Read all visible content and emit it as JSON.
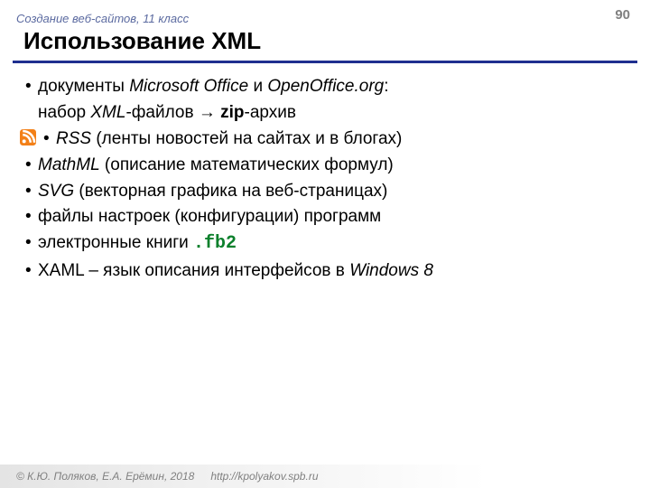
{
  "header": {
    "course": "Создание веб-сайтов, 11 класс"
  },
  "page_number": "90",
  "title": "Использование XML",
  "items": [
    {
      "pre": "документы ",
      "em1": "Microsoft Office",
      "mid": " и ",
      "em2": "OpenOffice.org",
      "post": ":",
      "sub_pre": "набор ",
      "sub_em": "XML",
      "sub_mid": "-файлов → ",
      "sub_b": "zip",
      "sub_post": "-архив"
    },
    {
      "em": "RSS",
      "rest": " (ленты новостей на сайтах и в блогах)"
    },
    {
      "em": "MathML",
      "rest": " (описание математических формул)"
    },
    {
      "em": "SVG",
      "rest": " (векторная графика на веб-страницах)"
    },
    {
      "plain": "файлы настроек (конфигурации) программ"
    },
    {
      "pre": "электронные книги ",
      "code": ".fb2"
    },
    {
      "pre": "XAML – язык описания интерфейсов в ",
      "em": "Windows 8"
    }
  ],
  "footer": {
    "copyright": "© К.Ю. Поляков, Е.А. Ерёмин, 2018",
    "url": "http://kpolyakov.spb.ru"
  },
  "colors": {
    "accent": "#1f2f8f",
    "code": "#0c802c",
    "header": "#5b6aa0"
  }
}
